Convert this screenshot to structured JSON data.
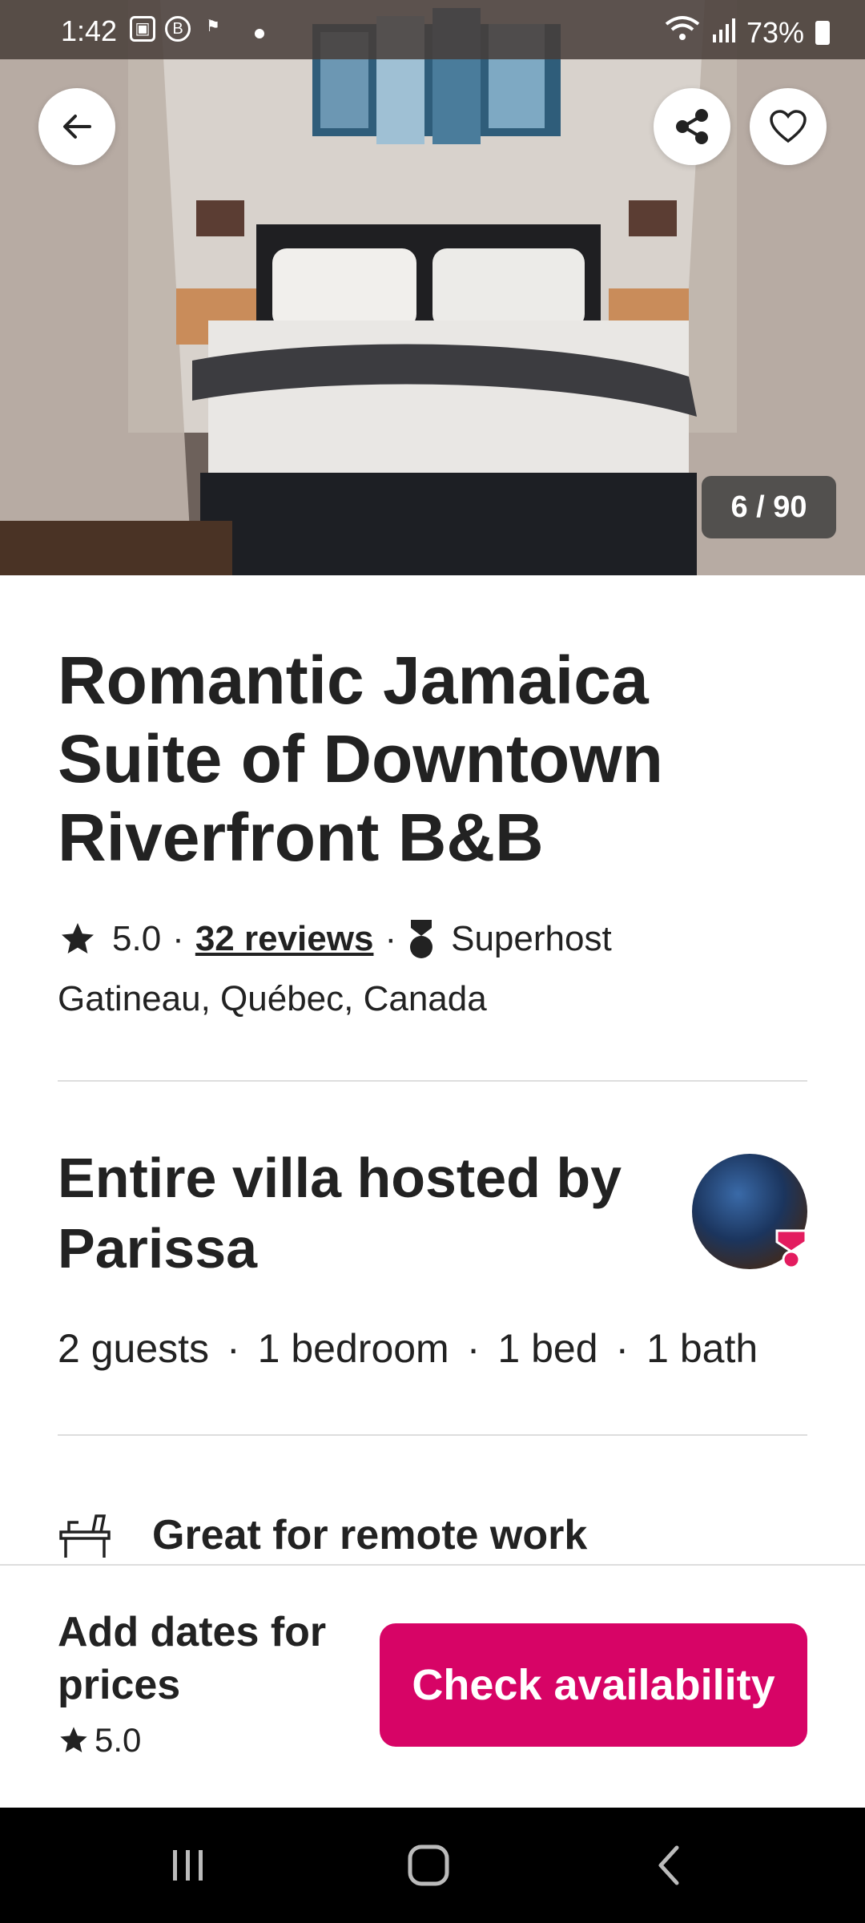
{
  "status_bar": {
    "time": "1:42",
    "battery": "73%",
    "icons": [
      "gallery-icon",
      "b-icon",
      "flag-icon",
      "wifi-icon",
      "signal-icon",
      "battery-icon"
    ]
  },
  "photo": {
    "counter": "6 / 90"
  },
  "listing": {
    "title": "Romantic Jamaica Suite of Downtown Riverfront B&B",
    "rating": "5.0",
    "reviews": "32 reviews",
    "superhost": "Superhost",
    "location": "Gatineau, Québec, Canada"
  },
  "host": {
    "heading": "Entire villa hosted by Parissa",
    "specs": [
      "2 guests",
      "1 bedroom",
      "1 bed",
      "1 bath"
    ]
  },
  "amenity": {
    "label": "Great for remote work"
  },
  "booking": {
    "prompt": "Add dates for prices",
    "rating": "5.0",
    "button": "Check availability"
  },
  "colors": {
    "primary": "#d70466",
    "text": "#222222",
    "divider": "#dddddd"
  }
}
